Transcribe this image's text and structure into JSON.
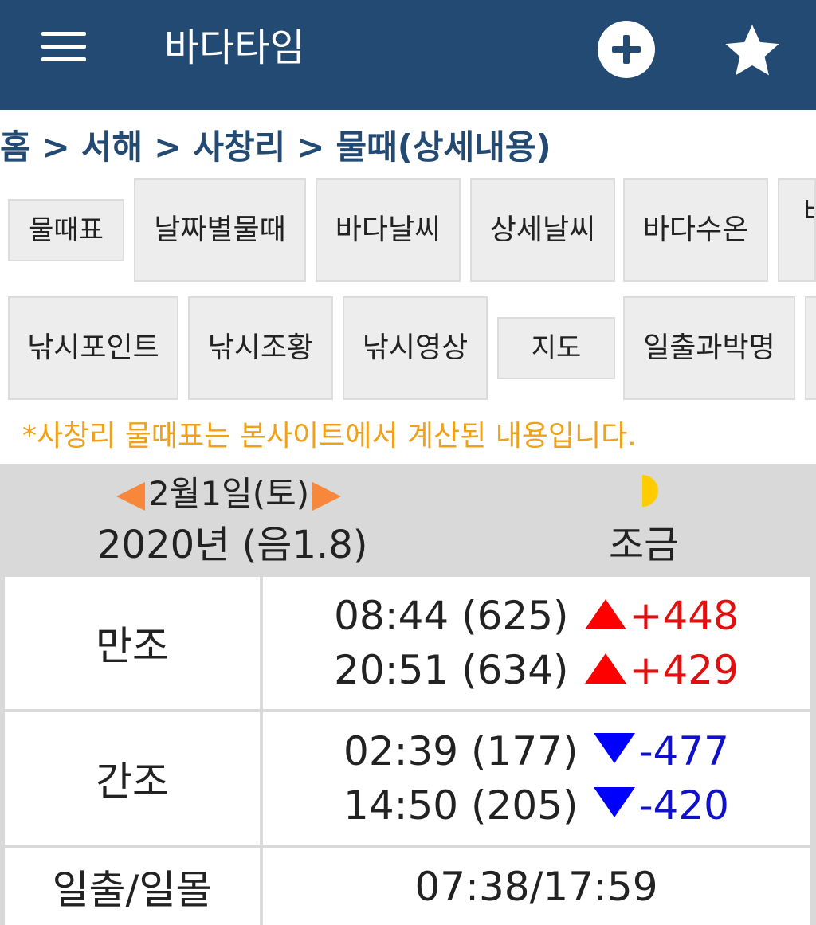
{
  "appbar": {
    "title": "바다타임",
    "menu_icon": "menu-icon",
    "add_icon": "add-circle-icon",
    "favorite_icon": "star-icon"
  },
  "breadcrumb": [
    "홈",
    "서해",
    "사창리",
    "물때(상세내용)"
  ],
  "breadcrumb_separator": ">",
  "nav_row1": [
    "물때표",
    "날짜별물때",
    "바다날씨",
    "상세날씨",
    "바다수온",
    "바"
  ],
  "nav_row2": [
    "낚시포인트",
    "낚시조황",
    "낚시영상",
    "지도",
    "일출과박명",
    ""
  ],
  "notice": "*사창리 물때표는 본사이트에서 계산된 내용입니다.",
  "tide": {
    "date": "2월1일(토)",
    "year_lunar": "2020년 (음1.8)",
    "moon_phase_icon": "half-moon-icon",
    "tide_name": "조금",
    "high_label": "만조",
    "high": [
      {
        "time": "08:44 (625)",
        "change": "+448"
      },
      {
        "time": "20:51 (634)",
        "change": "+429"
      }
    ],
    "low_label": "간조",
    "low": [
      {
        "time": "02:39 (177)",
        "change": "-477"
      },
      {
        "time": "14:50 (205)",
        "change": "-420"
      }
    ],
    "sun_label": "일출/일몰",
    "sun_times": "07:38/17:59"
  },
  "colors": {
    "appbar": "#234a72",
    "notice": "#f0a11a",
    "arrow": "#f7883b",
    "rise": "#e01010",
    "fall": "#1010c8",
    "moon": "#ffcc00"
  }
}
